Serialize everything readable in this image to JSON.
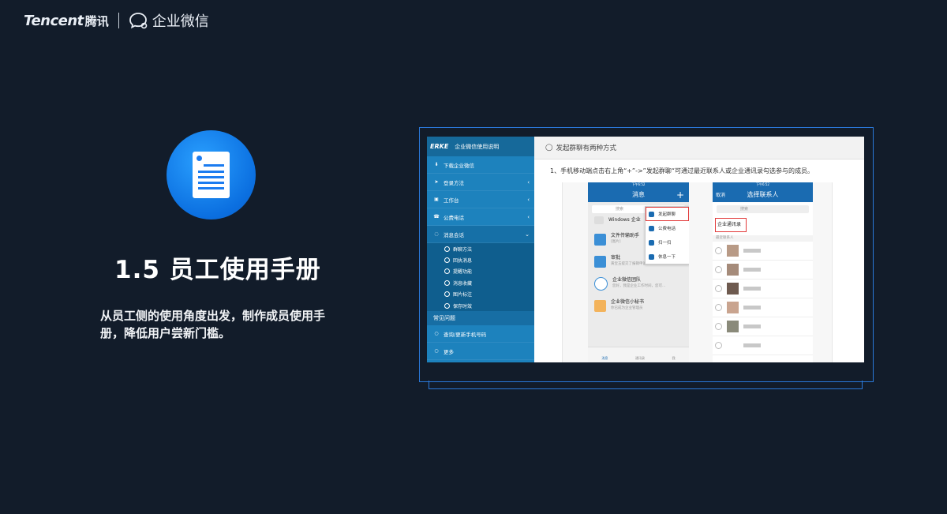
{
  "header": {
    "tencent_logo": "Tencent",
    "tencent_cn": "腾讯",
    "wework_name": "企业微信"
  },
  "hero": {
    "title": "1.5 员工使用手册",
    "description": "从员工侧的使用角度出发，制作成员使用手册，降低用户尝新门槛。",
    "icon": "document-icon"
  },
  "screenshot": {
    "sidebar": {
      "logo": "ERKE",
      "title": "企业微信使用说明",
      "items": [
        {
          "label": "下载企业微信",
          "icon": "download-icon",
          "chevron": ""
        },
        {
          "label": "登录方法",
          "icon": "send-icon",
          "chevron": "‹"
        },
        {
          "label": "工作台",
          "icon": "workbench-icon",
          "chevron": "‹"
        },
        {
          "label": "公费电话",
          "icon": "phone-icon",
          "chevron": "‹"
        },
        {
          "label": "消息会话",
          "icon": "chat-icon",
          "chevron": "⌄"
        }
      ],
      "subitems": [
        "群聊方法",
        "回执消息",
        "提醒功能",
        "消息收藏",
        "图片标注",
        "保存时效"
      ],
      "section": "常见问题",
      "faq_items": [
        {
          "label": "查询/更新手机号码",
          "icon": "circle-icon"
        },
        {
          "label": "更多",
          "icon": "circle-icon"
        }
      ]
    },
    "content": {
      "heading": "发起群聊有两种方式",
      "step": "1、手机移动端点击右上角“+”->”发起群聊“可通过最近联系人或企业通讯录勾选参与的成员。"
    },
    "phone1": {
      "status": "下午6:52",
      "title": "消息",
      "search": "搜索",
      "rows": [
        {
          "name": "Windows 企业",
          "sub": ""
        },
        {
          "name": "文件传输助手",
          "sub": "[图片]"
        },
        {
          "name": "审批",
          "sub": "黄宝玉提交了报销申请"
        },
        {
          "name": "企业微信团队",
          "sub": "您好，我是企业工作时间，您可..."
        },
        {
          "name": "企业微信小秘书",
          "sub": "你已成为企业管理员"
        }
      ],
      "popup": [
        "发起群聊",
        "公费电话",
        "扫一扫",
        "休息一下"
      ],
      "tabs": [
        "消息",
        "通讯录",
        "我"
      ]
    },
    "phone2": {
      "status": "下午6:52",
      "cancel": "取消",
      "title": "选择联系人",
      "search": "搜索",
      "group": "企业通讯录",
      "section": "最近联系人"
    }
  }
}
